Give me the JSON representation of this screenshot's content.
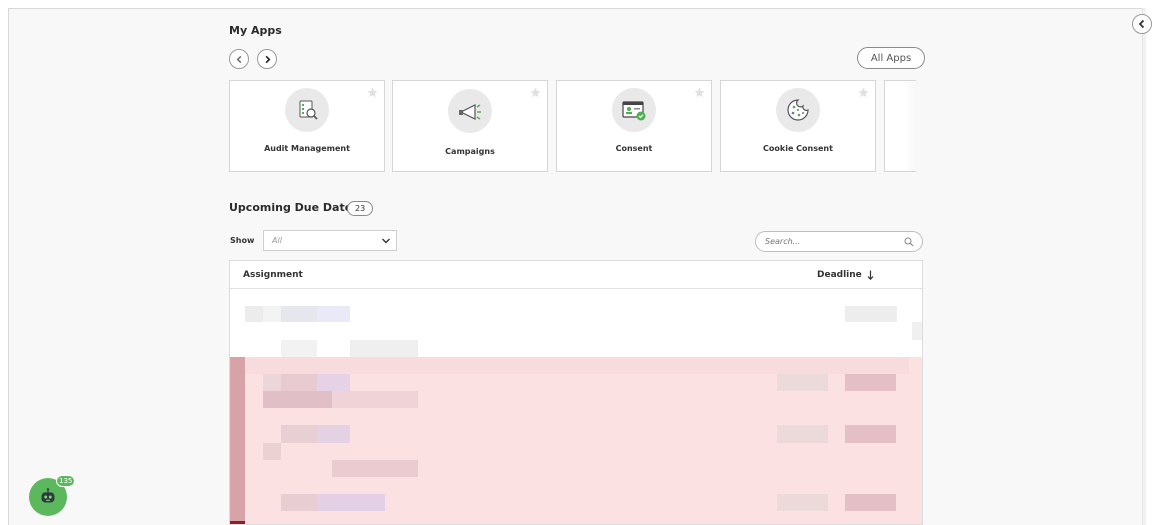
{
  "my_apps": {
    "title": "My Apps",
    "all_apps_label": "All Apps",
    "apps": [
      {
        "label": "Audit Management",
        "icon": "audit-icon"
      },
      {
        "label": "Campaigns",
        "icon": "megaphone-icon"
      },
      {
        "label": "Consent",
        "icon": "consent-icon"
      },
      {
        "label": "Cookie Consent",
        "icon": "cookie-icon"
      }
    ]
  },
  "due_dates": {
    "title": "Upcoming Due Dates",
    "count": "23",
    "show_label": "Show",
    "show_value": "All",
    "search_placeholder": "Search...",
    "columns": {
      "assignment": "Assignment",
      "deadline": "Deadline"
    }
  },
  "assistant": {
    "badge": "135"
  },
  "colors": {
    "accent": "#5cb85c",
    "overdue_row": "#fbe1e2",
    "overdue_bar": "#d7a3a8"
  }
}
